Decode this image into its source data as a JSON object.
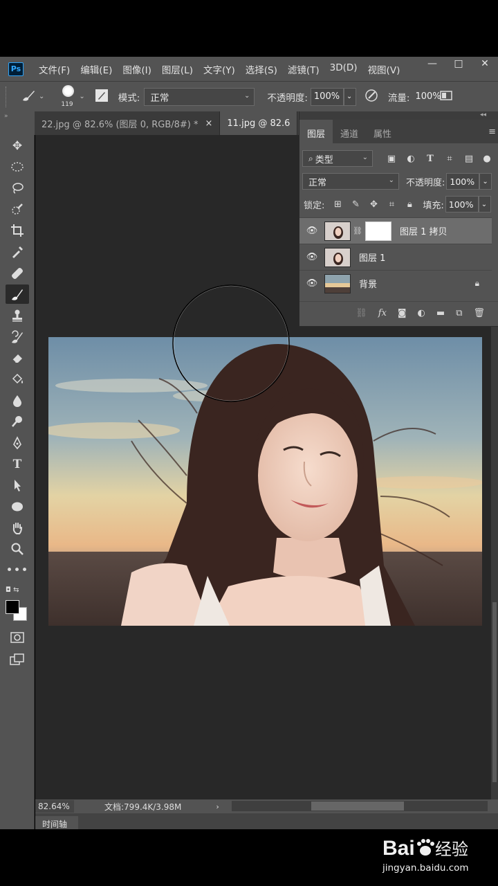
{
  "app": {
    "logo": "Ps"
  },
  "menu": [
    "文件(F)",
    "编辑(E)",
    "图像(I)",
    "图层(L)",
    "文字(Y)",
    "选择(S)",
    "滤镜(T)",
    "3D(D)",
    "视图(V)"
  ],
  "window_controls": {
    "minimize": "—",
    "restore": "□",
    "close": "✕"
  },
  "options": {
    "brush_size": "119",
    "mode_label": "模式:",
    "mode_value": "正常",
    "opacity_label": "不透明度:",
    "opacity_value": "100%",
    "flow_label": "流量:",
    "flow_value": "100%"
  },
  "tabs": [
    {
      "label": "22.jpg @ 82.6% (图层 0, RGB/8#) *",
      "close": "×"
    },
    {
      "label": "11.jpg @ 82.6"
    }
  ],
  "layers_panel": {
    "tabs": [
      "图层",
      "通道",
      "属性"
    ],
    "filter_kind": "类型",
    "blend_mode": "正常",
    "opacity_label": "不透明度:",
    "opacity_value": "100%",
    "lock_label": "锁定:",
    "fill_label": "填充:",
    "fill_value": "100%",
    "layers": [
      {
        "name": "图层 1 拷贝"
      },
      {
        "name": "图层 1"
      },
      {
        "name": "背景"
      }
    ]
  },
  "status": {
    "zoom": "82.64%",
    "doc_info": "文档:799.4K/3.98M",
    "timeline": "时间轴"
  },
  "watermark": {
    "text": "jingyan.baidu.com"
  },
  "colors": {
    "panel": "#535353",
    "canvas": "#282828",
    "accent": "#31a8ff"
  }
}
